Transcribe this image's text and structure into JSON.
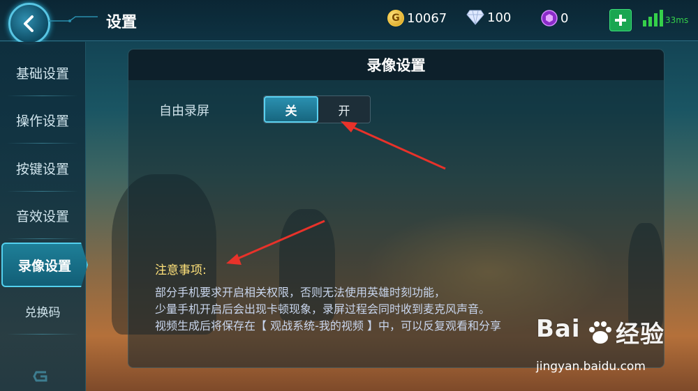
{
  "header": {
    "title": "设置",
    "gold": "10067",
    "gold_icon_letter": "G",
    "diamond": "100",
    "gem": "0",
    "ping": "33ms"
  },
  "sidebar": {
    "items": [
      {
        "label": "基础设置"
      },
      {
        "label": "操作设置"
      },
      {
        "label": "按键设置"
      },
      {
        "label": "音效设置"
      },
      {
        "label": "录像设置",
        "active": true
      },
      {
        "label": "兑换码"
      }
    ]
  },
  "panel": {
    "title": "录像设置",
    "free_record": {
      "label": "自由录屏",
      "off_label": "关",
      "on_label": "开",
      "selected": "关"
    },
    "notes": {
      "title": "注意事项:",
      "lines": [
        "部分手机要求开启相关权限，否则无法使用英雄时刻功能，",
        "少量手机开启后会出现卡顿现象，录屏过程会同时收到麦克风声音。",
        "视频生成后将保存在【 观战系统-我的视频 】中，可以反复观看和分享"
      ]
    }
  },
  "watermark": {
    "brand_left": "Bai",
    "brand_right": "经验",
    "url": "jingyan.baidu.com"
  },
  "colors": {
    "accent": "#53d0ee",
    "note_title": "#ffe27a",
    "ping_green": "#35d04a",
    "arrow_red": "#e8322a"
  }
}
